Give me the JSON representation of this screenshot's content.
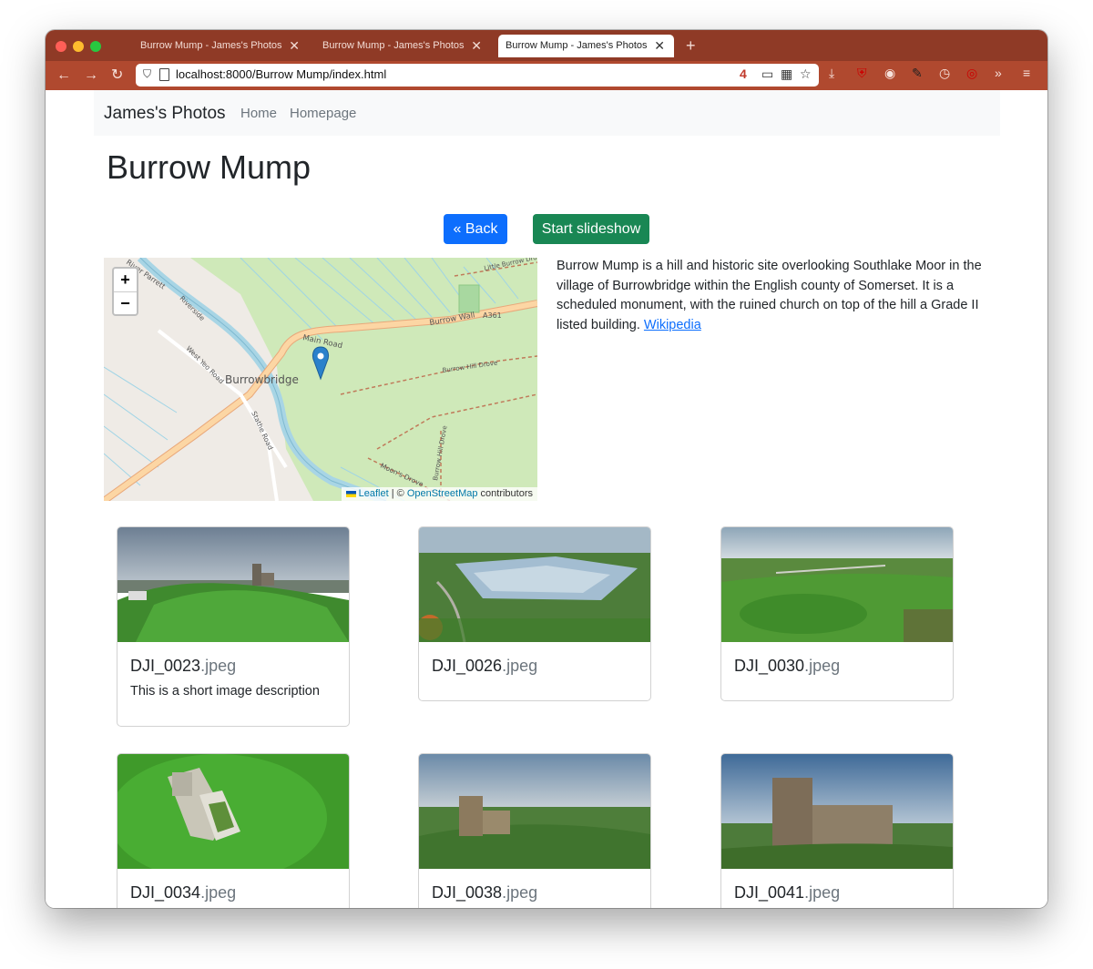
{
  "browser": {
    "tabs": [
      {
        "title": "Burrow Mump - James's Photos",
        "close": "✕"
      },
      {
        "title": "Burrow Mump - James's Photos",
        "close": "✕"
      },
      {
        "title": "Burrow Mump - James's Photos",
        "close": "✕",
        "active": true
      }
    ],
    "new_tab": "+",
    "url": "localhost:8000/Burrow Mump/index.html",
    "badge_count": "4",
    "nav_icons": [
      "back-arrow-icon",
      "forward-arrow-icon",
      "reload-icon"
    ],
    "extension_icons": [
      "download-icon",
      "ublock-icon",
      "extension-icon",
      "pin-icon",
      "clock-icon",
      "extension-red-icon",
      "overflow-icon",
      "menu-icon"
    ]
  },
  "navbar": {
    "brand": "James's Photos",
    "links": [
      "Home",
      "Homepage"
    ]
  },
  "page": {
    "title": "Burrow Mump",
    "back_label": "« Back",
    "slideshow_label": "Start slideshow",
    "description": "Burrow Mump is a hill and historic site overlooking Southlake Moor in the village of Burrowbridge within the English county of Somerset. It is a scheduled monument, with the ruined church on top of the hill a Grade II listed building. ",
    "wiki_link": "Wikipedia"
  },
  "map": {
    "zoom_in": "+",
    "zoom_out": "−",
    "attribution": {
      "leaflet": "Leaflet",
      "separator": " | © ",
      "osm": "OpenStreetMap",
      "suffix": " contributors"
    },
    "labels": {
      "town": "Burrowbridge",
      "main_road": "Main Road",
      "burrow_wall": "Burrow Wall",
      "a361": "A361",
      "riverside": "Riverside",
      "west_yeo": "West Yeo Road",
      "burrow_hill_drove": "Burrow Hill Drove",
      "burrow_hill_drove_2": "Burrow Hill Drove",
      "moons_drove": "Moon's Drove",
      "stathe_road": "Stathe Road",
      "little_burrow": "Little Burrow Drove",
      "parrett": "River Parrett"
    }
  },
  "gallery": [
    {
      "name": "DJI_0023",
      "ext": ".jpeg",
      "description": "This is a short image description"
    },
    {
      "name": "DJI_0026",
      "ext": ".jpeg",
      "description": ""
    },
    {
      "name": "DJI_0030",
      "ext": ".jpeg",
      "description": ""
    },
    {
      "name": "DJI_0034",
      "ext": ".jpeg",
      "description": ""
    },
    {
      "name": "DJI_0038",
      "ext": ".jpeg",
      "description": ""
    },
    {
      "name": "DJI_0041",
      "ext": ".jpeg",
      "description": ""
    }
  ],
  "colors": {
    "tabbar": "#8f3a26",
    "toolbar": "#b0492f",
    "primary": "#0d6efd",
    "success": "#198754"
  }
}
